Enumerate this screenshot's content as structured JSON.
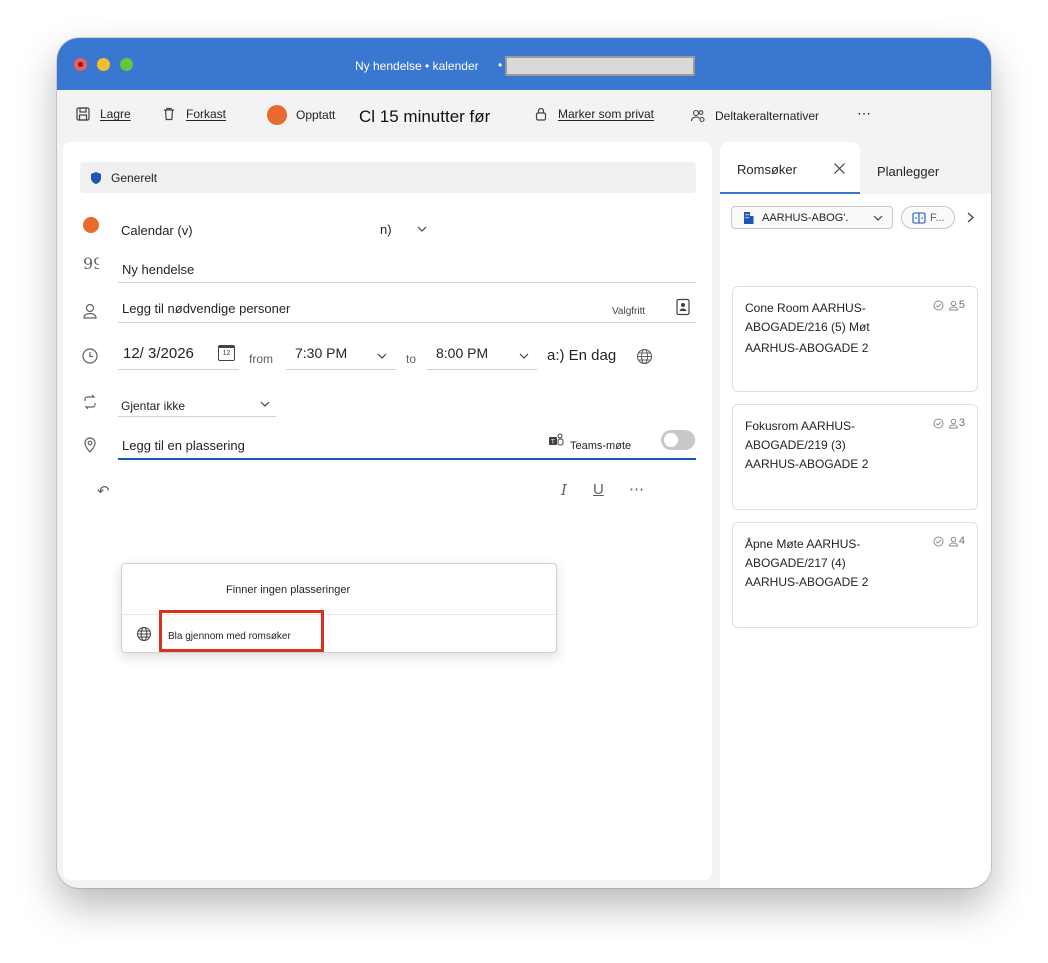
{
  "window": {
    "title": "Ny hendelse • kalender",
    "separator": "•"
  },
  "toolbar": {
    "save": "Lagre",
    "discard": "Forkast",
    "status": "Opptatt",
    "status_color": "#e86a2c",
    "reminder": "Cl 15 minutter før",
    "private": "Marker som privat",
    "attendee_options": "Deltakeralternativer",
    "more": "⋯"
  },
  "form": {
    "section": "Generelt",
    "calendar_name": "Calendar (v)",
    "calendar_suffix": "n)",
    "calendar_color": "#e86a2c",
    "title": "Ny hendelse",
    "people_placeholder": "Legg til nødvendige personer",
    "optional": "Valgfritt",
    "start_date": "12/ 3/2026",
    "date_badge": "12",
    "from_label": "from",
    "start_time": "7:30 PM",
    "to_label": "to",
    "end_time": "8:00 PM",
    "all_day": "a:) En dag",
    "repeat": "Gjentar ikke",
    "location_placeholder": "Legg til en plassering",
    "teams_label": "Teams-møte",
    "teams_enabled": false
  },
  "location_dropdown": {
    "empty_message": "Finner ingen plasseringer",
    "browse_label": "Bla gjennom med romsøker"
  },
  "editor": {
    "more": "⋯"
  },
  "side_panel": {
    "tabs": [
      {
        "label": "Romsøker",
        "active": true
      },
      {
        "label": "Planlegger",
        "active": false
      }
    ],
    "building_filter": "AARHUS-ABOG'.",
    "second_filter": "F...",
    "rooms": [
      {
        "name": "Cone Room AARHUS-ABOGADE/216 (5) Møt",
        "building": "AARHUS-ABOGADE 2",
        "capacity": "5"
      },
      {
        "name": "Fokusrom AARHUS-ABOGADE/219 (3)",
        "building": "AARHUS-ABOGADE 2",
        "capacity": "3"
      },
      {
        "name": "Åpne Møte AARHUS-ABOGADE/217 (4)",
        "building": "AARHUS-ABOGADE 2",
        "capacity": "4"
      }
    ]
  }
}
